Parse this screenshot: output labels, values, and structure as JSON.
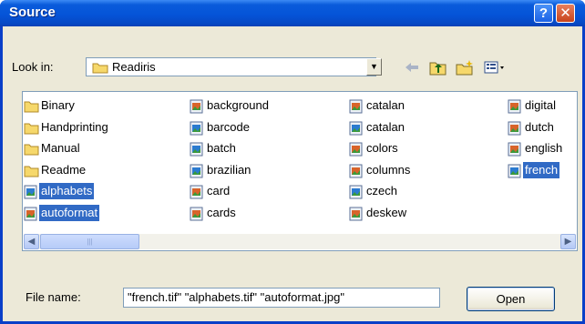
{
  "window": {
    "title": "Source",
    "help_glyph": "?",
    "close_glyph": "✕"
  },
  "lookin": {
    "label": "Look in:",
    "value": "Readiris"
  },
  "files": [
    {
      "name": "Binary",
      "type": "folder",
      "selected": false
    },
    {
      "name": "Handprinting",
      "type": "folder",
      "selected": false
    },
    {
      "name": "Manual",
      "type": "folder",
      "selected": false
    },
    {
      "name": "Readme",
      "type": "folder",
      "selected": false
    },
    {
      "name": "alphabets",
      "type": "tif",
      "selected": true
    },
    {
      "name": "autoformat",
      "type": "jpg",
      "selected": true
    },
    {
      "name": "background",
      "type": "jpg",
      "selected": false
    },
    {
      "name": "barcode",
      "type": "tif",
      "selected": false
    },
    {
      "name": "batch",
      "type": "tif",
      "selected": false
    },
    {
      "name": "brazilian",
      "type": "tif",
      "selected": false
    },
    {
      "name": "card",
      "type": "jpg",
      "selected": false
    },
    {
      "name": "cards",
      "type": "jpg",
      "selected": false
    },
    {
      "name": "catalan",
      "type": "jpg",
      "selected": false
    },
    {
      "name": "catalan",
      "type": "tif",
      "selected": false
    },
    {
      "name": "colors",
      "type": "jpg",
      "selected": false
    },
    {
      "name": "columns",
      "type": "jpg",
      "selected": false
    },
    {
      "name": "czech",
      "type": "tif",
      "selected": false
    },
    {
      "name": "deskew",
      "type": "jpg",
      "selected": false
    },
    {
      "name": "digital",
      "type": "jpg",
      "selected": false
    },
    {
      "name": "dutch",
      "type": "jpg",
      "selected": false
    },
    {
      "name": "english",
      "type": "jpg",
      "selected": false
    },
    {
      "name": "french",
      "type": "tif",
      "selected": true
    }
  ],
  "scrollbar": {
    "left_arrow": "◀",
    "right_arrow": "▶",
    "grip": "|||"
  },
  "filename": {
    "label": "File name:",
    "value": "\"french.tif\" \"alphabets.tif\" \"autoformat.jpg\""
  },
  "buttons": {
    "open": "Open"
  },
  "icons": {
    "lookin_folder": "folder-icon",
    "back": "back-arrow-icon",
    "up": "up-folder-icon",
    "new_folder": "new-folder-icon",
    "view": "view-menu-icon"
  }
}
